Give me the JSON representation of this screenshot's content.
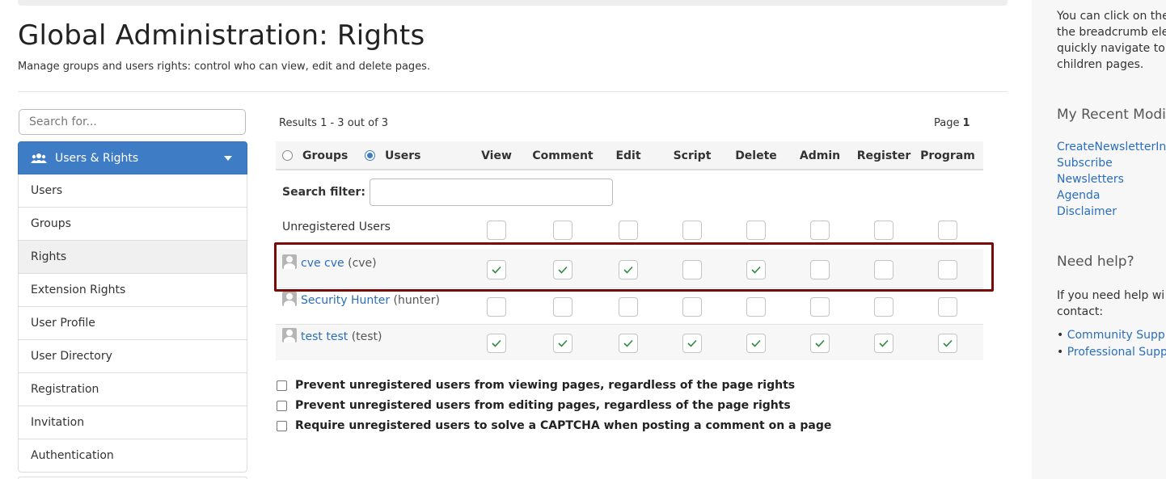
{
  "page": {
    "title": "Global Administration: Rights",
    "description": "Manage groups and users rights: control who can view, edit and delete pages."
  },
  "sidebar": {
    "search_placeholder": "Search for...",
    "section_title": "Users & Rights",
    "items": [
      {
        "label": "Users",
        "active": false
      },
      {
        "label": "Groups",
        "active": false
      },
      {
        "label": "Rights",
        "active": true
      },
      {
        "label": "Extension Rights",
        "active": false
      },
      {
        "label": "User Profile",
        "active": false
      },
      {
        "label": "User Directory",
        "active": false
      },
      {
        "label": "Registration",
        "active": false
      },
      {
        "label": "Invitation",
        "active": false
      },
      {
        "label": "Authentication",
        "active": false
      }
    ]
  },
  "rights_table": {
    "results_text": "Results 1 - 3 out of 3",
    "page_label": "Page",
    "page_number": "1",
    "groups_label": "Groups",
    "users_label": "Users",
    "selected_scope": "Users",
    "columns": [
      "View",
      "Comment",
      "Edit",
      "Script",
      "Delete",
      "Admin",
      "Register",
      "Program"
    ],
    "filter_label": "Search filter:",
    "filter_value": "",
    "unregistered_label": "Unregistered Users",
    "unregistered_rights": [
      false,
      false,
      false,
      false,
      false,
      false,
      false,
      false
    ],
    "rows": [
      {
        "display_name": "cve cve",
        "username": "(cve)",
        "rights": [
          true,
          true,
          true,
          false,
          true,
          false,
          false,
          false
        ],
        "highlighted": true
      },
      {
        "display_name": "Security Hunter",
        "username": "(hunter)",
        "rights": [
          false,
          false,
          false,
          false,
          false,
          false,
          false,
          false
        ],
        "highlighted": false
      },
      {
        "display_name": "test test",
        "username": "(test)",
        "rights": [
          true,
          true,
          true,
          true,
          true,
          true,
          true,
          true
        ],
        "highlighted": false
      }
    ]
  },
  "options": [
    {
      "label": "Prevent unregistered users from viewing pages, regardless of the page rights",
      "checked": false
    },
    {
      "label": "Prevent unregistered users from editing pages, regardless of the page rights",
      "checked": false
    },
    {
      "label": "Require unregistered users to solve a CAPTCHA when posting a comment on a page",
      "checked": false
    }
  ],
  "right_panel": {
    "tip_lines": [
      "You can click on the",
      "the breadcrumb ele",
      "quickly navigate to",
      "children pages."
    ],
    "recent_title": "My Recent Modi",
    "recent_links": [
      "CreateNewsletterIn",
      "Subscribe",
      "Newsletters",
      "Agenda",
      "Disclaimer"
    ],
    "help_title": "Need help?",
    "help_lines": [
      "If you need help wi",
      "contact:"
    ],
    "help_links": [
      "Community Supp",
      "Professional Supp"
    ]
  },
  "colors": {
    "accent": "#3e7cc6",
    "link": "#2a6ebb",
    "check": "#2e8b3e",
    "highlight_border": "#7a0a0a"
  }
}
